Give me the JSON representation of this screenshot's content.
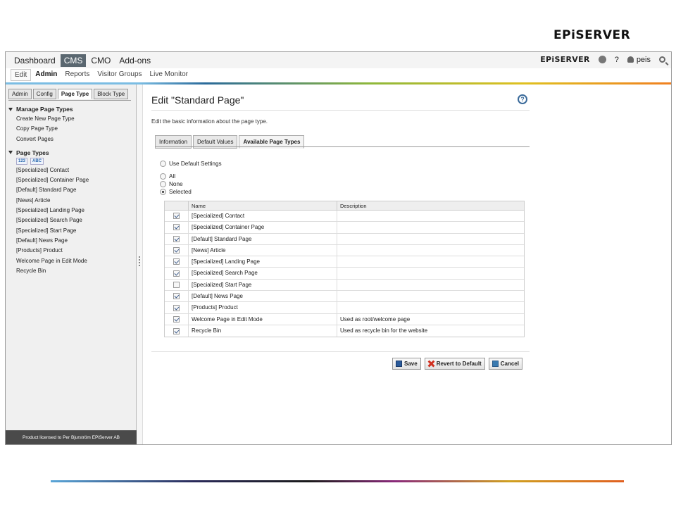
{
  "slide": {
    "logo": "EPiSERVER"
  },
  "topbar": {
    "nav": [
      "Dashboard",
      "CMS",
      "CMO",
      "Add-ons"
    ],
    "active_index": 1,
    "brand": "EPiSERVER",
    "help": "?",
    "user": "peis"
  },
  "subnav": {
    "items": [
      "Edit",
      "Admin",
      "Reports",
      "Visitor Groups",
      "Live Monitor"
    ]
  },
  "leftpane": {
    "tabs": [
      "Admin",
      "Config",
      "Page Type",
      "Block Type"
    ],
    "group1": {
      "title": "Manage Page Types",
      "items": [
        "Create New Page Type",
        "Copy Page Type",
        "Convert Pages"
      ]
    },
    "group2": {
      "title": "Page Types",
      "sort_numeric": "123",
      "sort_alpha": "ABC",
      "items": [
        "[Specialized] Contact",
        "[Specialized] Container Page",
        "[Default] Standard Page",
        "[News] Article",
        "[Specialized] Landing Page",
        "[Specialized] Search Page",
        "[Specialized] Start Page",
        "[Default] News Page",
        "[Products] Product",
        "Welcome Page in Edit Mode",
        "Recycle Bin"
      ]
    },
    "license": "Product licensed to Per Bjurström EPiServer AB"
  },
  "main": {
    "title": "Edit \"Standard Page\"",
    "help": "?",
    "description": "Edit the basic information about the page type.",
    "tabs": [
      "Information",
      "Default Values",
      "Available Page Types"
    ],
    "radios": {
      "use_default": "Use Default Settings",
      "all": "All",
      "none": "None",
      "selected": "Selected"
    },
    "grid": {
      "col_name": "Name",
      "col_desc": "Description",
      "rows": [
        {
          "name": "[Specialized] Contact",
          "desc": "",
          "checked": true
        },
        {
          "name": "[Specialized] Container Page",
          "desc": "",
          "checked": true
        },
        {
          "name": "[Default] Standard Page",
          "desc": "",
          "checked": true
        },
        {
          "name": "[News] Article",
          "desc": "",
          "checked": true
        },
        {
          "name": "[Specialized] Landing Page",
          "desc": "",
          "checked": true
        },
        {
          "name": "[Specialized] Search Page",
          "desc": "",
          "checked": true
        },
        {
          "name": "[Specialized] Start Page",
          "desc": "",
          "checked": false
        },
        {
          "name": "[Default] News Page",
          "desc": "",
          "checked": true
        },
        {
          "name": "[Products] Product",
          "desc": "",
          "checked": true
        },
        {
          "name": "Welcome Page in Edit Mode",
          "desc": "Used as root/welcome page",
          "checked": true
        },
        {
          "name": "Recycle Bin",
          "desc": "Used as recycle bin for the website",
          "checked": true
        }
      ]
    },
    "buttons": {
      "save": "Save",
      "revert": "Revert to Default",
      "cancel": "Cancel"
    }
  }
}
